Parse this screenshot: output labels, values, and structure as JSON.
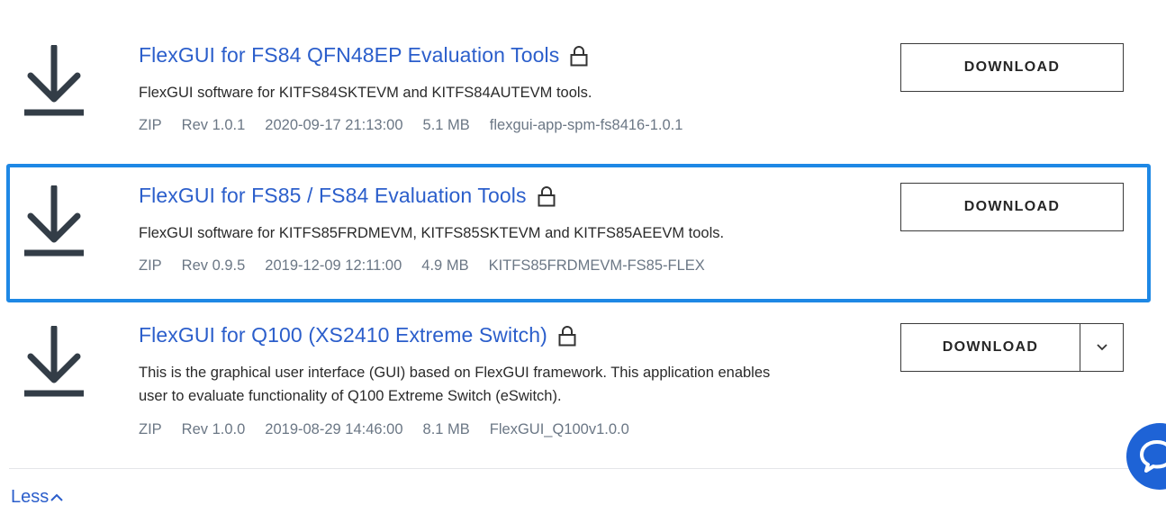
{
  "items": [
    {
      "title": "FlexGUI for FS84 QFN48EP Evaluation Tools",
      "description": "FlexGUI software for KITFS84SKTEVM and KITFS84AUTEVM tools.",
      "meta": {
        "type": "ZIP",
        "rev": "Rev 1.0.1",
        "date": "2020-09-17 21:13:00",
        "size": "5.1 MB",
        "file": "flexgui-app-spm-fs8416-1.0.1"
      },
      "button": "DOWNLOAD"
    },
    {
      "title": "FlexGUI for FS85 / FS84 Evaluation Tools",
      "description": "FlexGUI software for KITFS85FRDMEVM, KITFS85SKTEVM and KITFS85AEEVM tools.",
      "meta": {
        "type": "ZIP",
        "rev": "Rev 0.9.5",
        "date": "2019-12-09 12:11:00",
        "size": "4.9 MB",
        "file": "KITFS85FRDMEVM-FS85-FLEX"
      },
      "button": "DOWNLOAD"
    },
    {
      "title": "FlexGUI for Q100 (XS2410 Extreme Switch)",
      "description_line1": "This is the graphical user interface (GUI) based on FlexGUI framework. This application enables",
      "description_line2": "user to evaluate functionality of Q100 Extreme Switch (eSwitch).",
      "meta": {
        "type": "ZIP",
        "rev": "Rev 1.0.0",
        "date": "2019-08-29 14:46:00",
        "size": "8.1 MB",
        "file": "FlexGUI_Q100v1.0.0"
      },
      "button": "DOWNLOAD"
    }
  ],
  "less_label": "Less",
  "icons": {
    "download": "download-icon",
    "lock": "lock-icon",
    "caret": "chevron-down-icon",
    "less_caret": "chevron-up-icon",
    "chat": "chat-icon"
  },
  "colors": {
    "link": "#2b5ecb",
    "selection": "#1e88e5",
    "chat": "#1e63d6",
    "meta": "#6b7785"
  }
}
